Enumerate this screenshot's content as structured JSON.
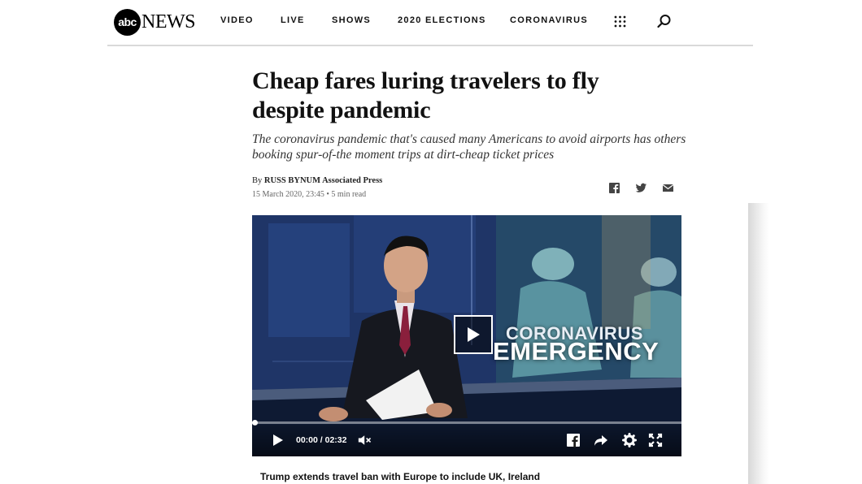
{
  "header": {
    "logo": {
      "mark": "abc",
      "word": "NEWS"
    },
    "nav": [
      {
        "label": "VIDEO"
      },
      {
        "label": "LIVE"
      },
      {
        "label": "SHOWS"
      },
      {
        "label": "2020 ELECTIONS"
      },
      {
        "label": "CORONAVIRUS"
      }
    ],
    "icons": {
      "menu": "grid-menu-icon",
      "search": "search-icon"
    }
  },
  "article": {
    "headline": "Cheap fares luring travelers to fly despite pandemic",
    "dek": "The coronavirus pandemic that's caused many Americans to avoid airports has others booking spur-of-the moment trips at dirt-cheap ticket prices",
    "byline_prefix": "By",
    "author": "RUSS BYNUM Associated Press",
    "date": "15 March 2020, 23:45",
    "read_time": "• 5 min read",
    "share_icons": [
      "facebook-icon",
      "twitter-icon",
      "email-icon"
    ]
  },
  "video": {
    "overlay_line1": "CORONAVIRUS",
    "overlay_line2": "EMERGENCY",
    "time": "00:00 / 02:32",
    "progress": 0,
    "controls": [
      "play-icon",
      "mute-icon",
      "facebook-icon",
      "share-icon",
      "settings-icon",
      "fullscreen-icon"
    ],
    "caption": "Trump extends travel ban with Europe to include UK, Ireland"
  },
  "colors": {
    "text": "#111111",
    "rule": "#d9d9d9",
    "video_bg": "#1b2d57"
  }
}
